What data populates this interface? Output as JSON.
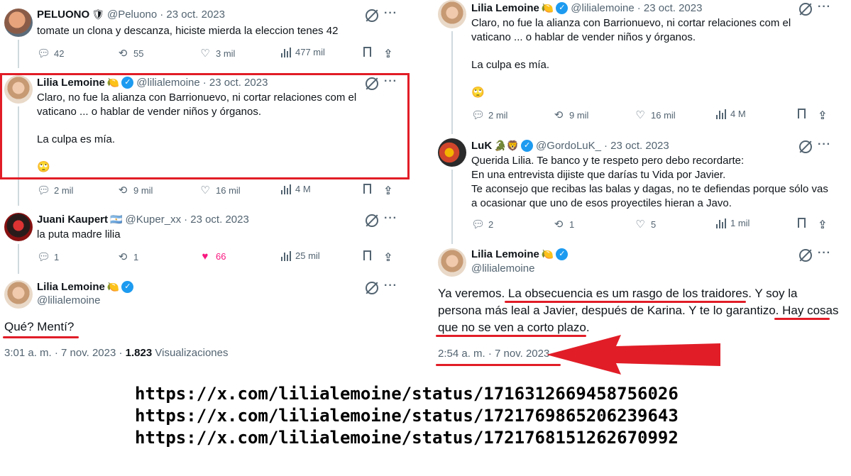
{
  "left": {
    "tweets": [
      {
        "name": "PELUONO",
        "emoji": "🛡",
        "handle": "@Peluono",
        "date": "· 23 oct. 2023",
        "text": "tomate un clona y descanza, hiciste mierda la eleccion tenes 42",
        "replies": "42",
        "reposts": "55",
        "likes": "3 mil",
        "views": "477 mil"
      },
      {
        "name": "Lilia Lemoine",
        "emoji": "🍋",
        "handle": "@lilialemoine",
        "date": "· 23 oct. 2023",
        "text_lines": [
          "Claro, no fue la alianza con Barrionuevo, ni cortar relaciones com el",
          "vaticano ... o hablar de vender niños y órganos.",
          "",
          "La culpa es mía.",
          "",
          "🙄"
        ],
        "replies": "2 mil",
        "reposts": "9 mil",
        "likes": "16 mil",
        "views": "4 M"
      },
      {
        "name": "Juani Kaupert",
        "emoji": "🇦🇷",
        "handle": "@Kuper_xx",
        "date": "· 23 oct. 2023",
        "text": "la puta madre lilia",
        "replies": "1",
        "reposts": "1",
        "likes": "66",
        "views": "25 mil"
      }
    ],
    "main": {
      "name": "Lilia Lemoine",
      "emoji": "🍋",
      "handle": "@lilialemoine",
      "text": "Qué? Mentí?",
      "time": "3:01 a. m. · 7 nov. 2023 ·",
      "views_count": "1.823",
      "views_label": "Visualizaciones"
    }
  },
  "right": {
    "tweets": [
      {
        "name": "Lilia Lemoine",
        "emoji": "🍋",
        "handle": "@lilialemoine",
        "date": "· 23 oct. 2023",
        "text_lines": [
          "Claro, no fue la alianza con Barrionuevo, ni cortar relaciones com el",
          "vaticano ... o hablar de vender niños y órganos.",
          "",
          "La culpa es mía.",
          "",
          "🙄"
        ],
        "replies": "2 mil",
        "reposts": "9 mil",
        "likes": "16 mil",
        "views": "4 M"
      },
      {
        "name": "LuK",
        "emoji": "🐊🦁",
        "handle": "@GordoLuK_",
        "date": "· 23 oct. 2023",
        "text_lines": [
          "Querida Lilia. Te banco y te respeto pero debo recordarte:",
          "En una entrevista dijiste que darías tu Vida por Javier.",
          "Te aconsejo que recibas las balas y dagas, no te defiendas porque sólo vas",
          "a ocasionar que uno de esos proyectiles hieran a Javo."
        ],
        "replies": "2",
        "reposts": "1",
        "likes": "5",
        "views": "1 mil"
      }
    ],
    "main": {
      "name": "Lilia Lemoine",
      "emoji": "🍋",
      "handle": "@lilialemoine",
      "text_lines": [
        "Ya veremos. La obsecuencia es um rasgo de los traidores. Y soy la",
        "persona más leal a Javier, después de Karina. Y te lo garantizo. Hay cosas",
        "que no se ven a corto plazo."
      ],
      "time": "2:54 a. m. · 7 nov. 2023"
    }
  },
  "urls": [
    "https://x.com/lilialemoine/status/1716312669458756026",
    "https://x.com/lilialemoine/status/1721769865206239643",
    "https://x.com/lilialemoine/status/1721768151262670992"
  ],
  "colors": {
    "highlight_red": "#e11d27",
    "verified_blue": "#1d9bf0",
    "like_pink": "#f91880",
    "muted": "#536471"
  }
}
